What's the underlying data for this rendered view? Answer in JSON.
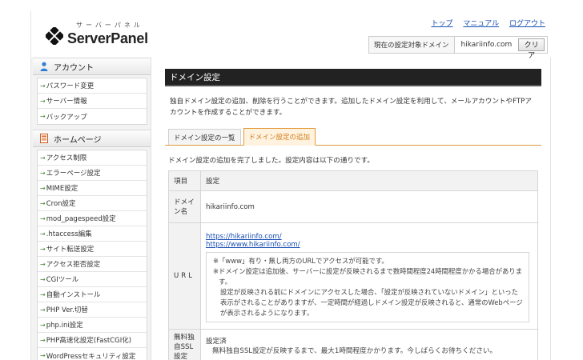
{
  "header": {
    "logo_kana": "サーバーパネル",
    "logo_text": "ServerPanel",
    "links": [
      "トップ",
      "マニュアル",
      "ログアウト"
    ],
    "domain_label": "現在の設定対象ドメイン",
    "domain_value": "hikariinfo.com",
    "clear_label": "クリア"
  },
  "sidebar": {
    "sections": [
      {
        "title": "アカウント",
        "icon": "person-icon",
        "items": [
          "パスワード変更",
          "サーバー情報",
          "バックアップ"
        ]
      },
      {
        "title": "ホームページ",
        "icon": "document-icon",
        "items": [
          "アクセス制限",
          "エラーページ設定",
          "MIME設定",
          "Cron設定",
          "mod_pagespeed設定",
          ".htaccess編集",
          "サイト転送設定",
          "アクセス拒否設定",
          "CGIツール",
          "自動インストール",
          "PHP Ver.切替",
          "php.ini設定",
          "PHP高速化設定(FastCGI化)",
          "WordPressセキュリティ設定"
        ]
      }
    ],
    "arrow": "→"
  },
  "main": {
    "title": "ドメイン設定",
    "intro": "独自ドメイン設定の追加、削除を行うことができます。追加したドメイン設定を利用して、メールアカウントやFTPアカウントを作成することができます。",
    "tabs": [
      {
        "label": "ドメイン設定の一覧",
        "active": false
      },
      {
        "label": "ドメイン設定の追加",
        "active": true
      }
    ],
    "done_message": "ドメイン設定の追加を完了しました。設定内容は以下の通りです。",
    "table": {
      "col_item": "項目",
      "col_setting": "設定",
      "rows": {
        "domain_key": "ドメイン名",
        "domain_val": "hikariinfo.com",
        "url_key": "URL",
        "url_http": "https://hikariinfo.com/",
        "url_www": "https://www.hikariinfo.com/",
        "note_mark": "※",
        "note1": "「www」有り・無し両方のURLでアクセスが可能です。",
        "note2": "ドメイン設定は追加後、サーバーに設定が反映されるまで数時間程度24時間程度かかる場合があります。",
        "note3": "設定が反映される前にドメインにアクセスした場合、「設定が反映されていないドメイン」といった表示がされることがありますが、一定時間が経過しドメイン設定が反映されると、通常のWebページが表示されるようになります。",
        "ssl_key": "無料独自SSL設定",
        "ssl_val": "設定済",
        "ssl_note": "無料独自SSL設定が反映するまで、最大1時間程度かかります。今しばらくお待ちください。"
      }
    }
  }
}
